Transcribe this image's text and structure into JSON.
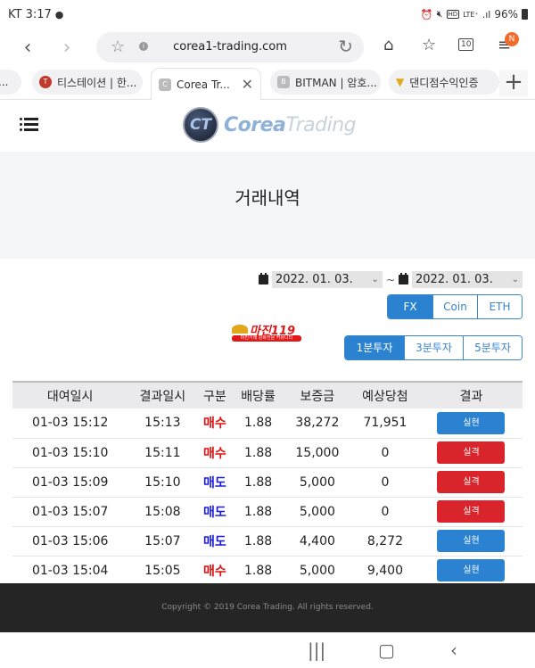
{
  "status_bar": {
    "carrier_time": "KT 3:17",
    "chat_icon": "chat-bubble-icon",
    "right_icons": [
      "alarm-icon",
      "mute-icon",
      "hd-icon",
      "lte-icon",
      "signal-icon"
    ],
    "hd": "HD",
    "lte": "LTE⁺",
    "battery": "96%"
  },
  "browser": {
    "url": "corea1-trading.com",
    "tab_count": "10",
    "menu_badge": "N",
    "tabs": [
      {
        "label": "...",
        "favicon": ""
      },
      {
        "label": "티스테이션 | 한...",
        "favicon": "T"
      },
      {
        "label": "Corea Tr...",
        "favicon": "C",
        "active": true
      },
      {
        "label": "BITMAN | 암호...",
        "favicon": "B"
      },
      {
        "label": "댄디점수익인증",
        "favicon": ""
      }
    ]
  },
  "site": {
    "logo_emblem": "CT",
    "logo_text_bold": "Corea",
    "logo_text_light": "Trading"
  },
  "page": {
    "title": "거래내역"
  },
  "filters": {
    "date_from": "2022. 01. 03.",
    "date_to": "2022. 01. 03.",
    "separator": "~",
    "markets": [
      {
        "label": "FX",
        "active": true
      },
      {
        "label": "Coin",
        "active": false
      },
      {
        "label": "ETH",
        "active": false
      }
    ],
    "intervals": [
      {
        "label": "1분투자",
        "active": true
      },
      {
        "label": "3분투자",
        "active": false
      },
      {
        "label": "5분투자",
        "active": false
      }
    ]
  },
  "banner": {
    "title": "마진119",
    "subtitle": "마진거래 강화전문 커뮤니티"
  },
  "table": {
    "headers": [
      "대여일시",
      "결과일시",
      "구분",
      "배당률",
      "보증금",
      "예상당첨",
      "결과"
    ],
    "rows": [
      {
        "start": "01-03 15:12",
        "end": "15:13",
        "type": "매수",
        "type_kind": "buy",
        "rate": "1.88",
        "deposit": "38,272",
        "expected": "71,951",
        "result": "실현",
        "result_kind": "win"
      },
      {
        "start": "01-03 15:10",
        "end": "15:11",
        "type": "매수",
        "type_kind": "buy",
        "rate": "1.88",
        "deposit": "15,000",
        "expected": "0",
        "result": "실격",
        "result_kind": "lose"
      },
      {
        "start": "01-03 15:09",
        "end": "15:10",
        "type": "매도",
        "type_kind": "sell",
        "rate": "1.88",
        "deposit": "5,000",
        "expected": "0",
        "result": "실격",
        "result_kind": "lose"
      },
      {
        "start": "01-03 15:07",
        "end": "15:08",
        "type": "매도",
        "type_kind": "sell",
        "rate": "1.88",
        "deposit": "5,000",
        "expected": "0",
        "result": "실격",
        "result_kind": "lose"
      },
      {
        "start": "01-03 15:06",
        "end": "15:07",
        "type": "매도",
        "type_kind": "sell",
        "rate": "1.88",
        "deposit": "4,400",
        "expected": "8,272",
        "result": "실현",
        "result_kind": "win"
      },
      {
        "start": "01-03 15:04",
        "end": "15:05",
        "type": "매수",
        "type_kind": "buy",
        "rate": "1.88",
        "deposit": "5,000",
        "expected": "9,400",
        "result": "실현",
        "result_kind": "win"
      }
    ]
  },
  "footer": {
    "copyright": "Copyright © 2019 Corea Trading. All rights reserved."
  },
  "colors": {
    "accent_blue": "#2a82d0",
    "buy_red": "#e01010",
    "sell_blue": "#1a1ae0",
    "lose_red": "#d8242a",
    "footer_bg": "#252525"
  }
}
